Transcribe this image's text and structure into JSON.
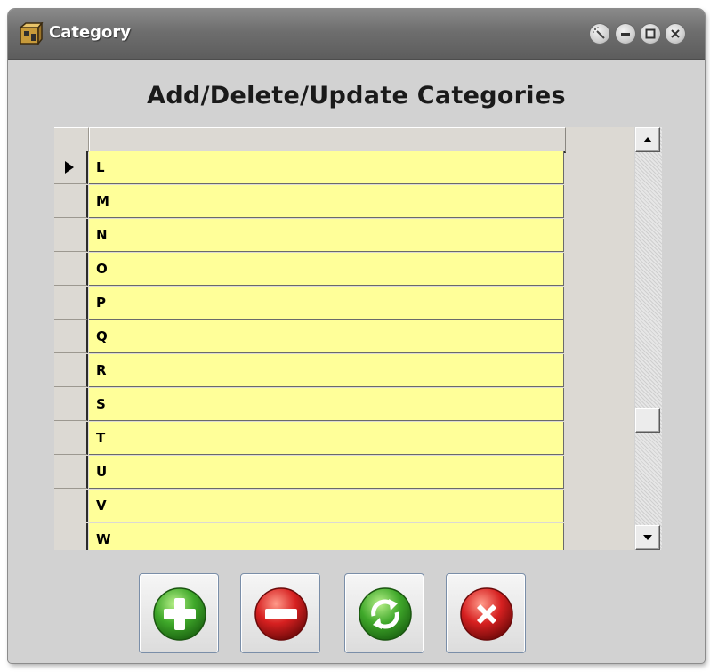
{
  "window": {
    "title": "Category",
    "controls": [
      "wand-icon",
      "minimize-icon",
      "maximize-icon",
      "close-icon"
    ]
  },
  "heading": "Add/Delete/Update Categories",
  "grid": {
    "header": "",
    "rows": [
      "L",
      "M",
      "N",
      "O",
      "P",
      "Q",
      "R",
      "S",
      "T",
      "U",
      "V",
      "W"
    ],
    "current_row": "L",
    "cell_color": "#ffff99"
  },
  "buttons": [
    {
      "name": "add-button",
      "icon": "plus-icon",
      "color": "#3fa82a"
    },
    {
      "name": "delete-button",
      "icon": "minus-icon",
      "color": "#d62020"
    },
    {
      "name": "update-button",
      "icon": "refresh-icon",
      "color": "#3fa82a"
    },
    {
      "name": "close-form-button",
      "icon": "x-icon",
      "color": "#d62020"
    }
  ]
}
